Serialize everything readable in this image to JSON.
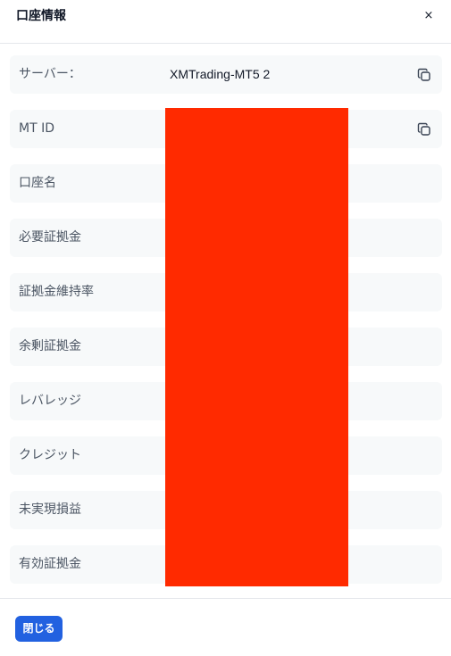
{
  "dialog": {
    "title": "口座情報",
    "close_icon": "close-icon",
    "close_glyph": "×"
  },
  "rows": [
    {
      "label": "サーバー：",
      "value": "XMTrading-MT5 2",
      "copy_icon": "copy-icon"
    },
    {
      "label": "MT ID",
      "value": "",
      "copy_icon": "copy-icon"
    },
    {
      "label": "口座名",
      "value": ""
    },
    {
      "label": "必要証拠金",
      "value": ""
    },
    {
      "label": "証拠金維持率",
      "value": ""
    },
    {
      "label": "余剰証拠金",
      "value": ""
    },
    {
      "label": "レバレッジ",
      "value": ""
    },
    {
      "label": "クレジット",
      "value": ""
    },
    {
      "label": "未実現損益",
      "value": ""
    },
    {
      "label": "有効証拠金",
      "value": ""
    }
  ],
  "footer": {
    "close_button_label": "閉じる"
  },
  "colors": {
    "accent": "#2261e0",
    "redaction": "#ff2a00",
    "row_background": "#f7f9fa"
  }
}
